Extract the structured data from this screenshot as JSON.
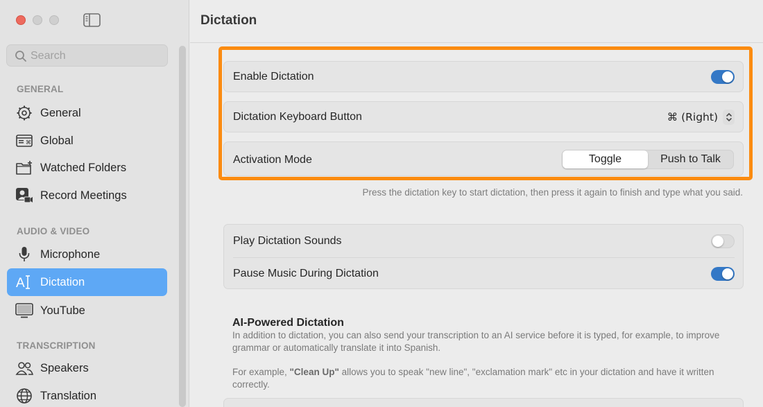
{
  "sidebar": {
    "search_placeholder": "Search",
    "sections": {
      "general": "GENERAL",
      "audio_video": "AUDIO & VIDEO",
      "transcription": "TRANSCRIPTION"
    },
    "items": [
      {
        "label": "General",
        "icon": "gear-icon"
      },
      {
        "label": "Global",
        "icon": "keyboard-icon"
      },
      {
        "label": "Watched Folders",
        "icon": "folder-plus-icon"
      },
      {
        "label": "Record Meetings",
        "icon": "person-video-icon"
      },
      {
        "label": "Microphone",
        "icon": "microphone-icon"
      },
      {
        "label": "Dictation",
        "icon": "text-cursor-icon",
        "active": true
      },
      {
        "label": "YouTube",
        "icon": "display-icon"
      },
      {
        "label": "Speakers",
        "icon": "people-icon"
      },
      {
        "label": "Translation",
        "icon": "globe-icon"
      }
    ],
    "active_color": "#5ea8f5"
  },
  "main": {
    "title": "Dictation",
    "enable_dictation": {
      "label": "Enable Dictation",
      "on": true
    },
    "keyboard_button": {
      "label": "Dictation Keyboard Button",
      "value": "⌘ (Right)"
    },
    "activation_mode": {
      "label": "Activation Mode",
      "options": [
        "Toggle",
        "Push to Talk"
      ],
      "selected": "Toggle"
    },
    "activation_hint": "Press the dictation key to start dictation, then press it again to finish and type what you said.",
    "play_sounds": {
      "label": "Play Dictation Sounds",
      "on": false
    },
    "pause_music": {
      "label": "Pause Music During Dictation",
      "on": true
    },
    "ai": {
      "title": "AI-Powered Dictation",
      "desc1": "In addition to dictation, you can also send your transcription to an AI service before it is typed, for example, to improve grammar or automatically translate it into Spanish.",
      "desc2_prefix": "For example, ",
      "desc2_bold": "\"Clean Up\"",
      "desc2_suffix": " allows you to speak \"new line\", \"exclamation mark\" etc in your dictation and have it written correctly."
    },
    "highlight_color": "#fb8b10",
    "switch_on_color": "#3478c6"
  }
}
